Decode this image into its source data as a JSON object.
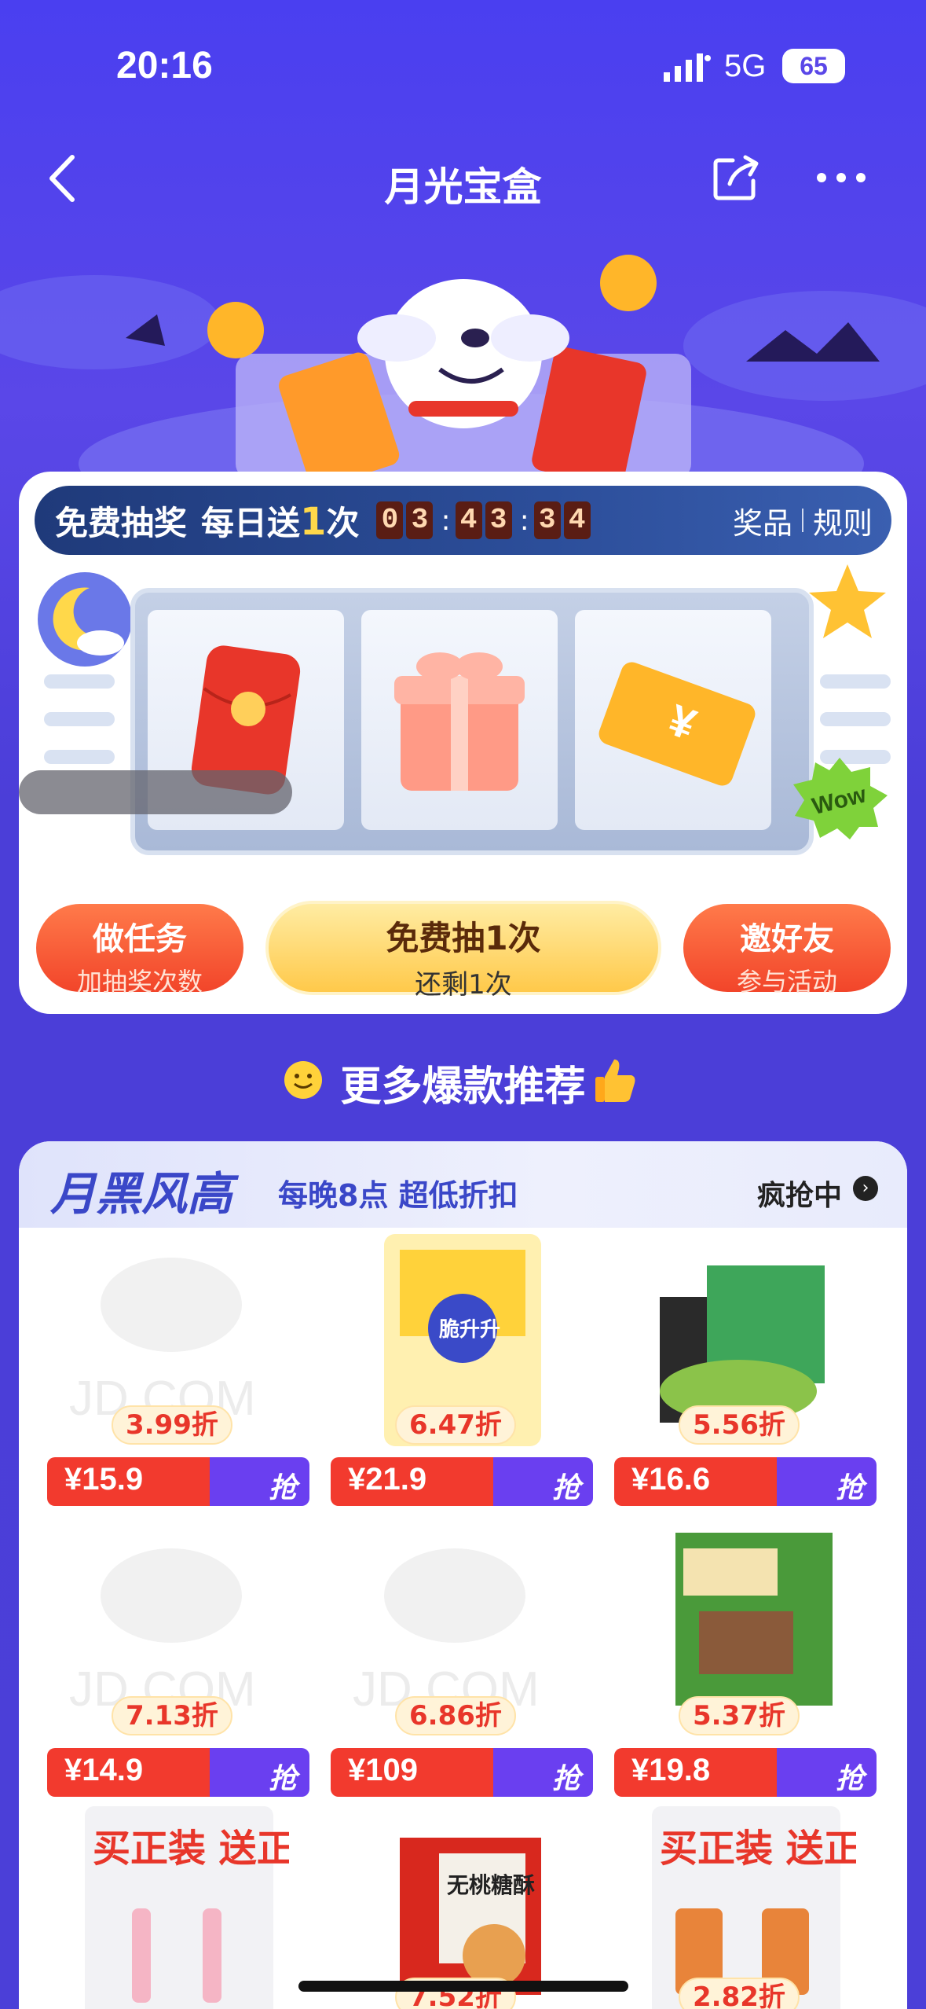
{
  "status_bar": {
    "time": "20:16",
    "network": "5G",
    "battery": "65"
  },
  "nav": {
    "title": "月光宝盒",
    "back_icon": "chevron-left-icon",
    "share_icon": "share-icon",
    "more_icon": "more-icon"
  },
  "lottery": {
    "title": "免费抽奖",
    "daily_prefix": "每日送",
    "daily_count": "1",
    "daily_suffix": "次",
    "countdown": [
      "0",
      "3",
      "4",
      "3",
      "3",
      "4"
    ],
    "prizes_link": "奖品",
    "rules_link": "规则",
    "slots": [
      "red-envelope-icon",
      "gift-box-icon",
      "coupon-icon"
    ],
    "task_button": {
      "label": "做任务",
      "sub": "加抽奖次数"
    },
    "draw_button": {
      "label": "免费抽1次",
      "sub": "还剩1次"
    },
    "invite_button": {
      "label": "邀好友",
      "sub": "参与活动"
    }
  },
  "section": {
    "title": "更多爆款推荐"
  },
  "deals": {
    "brand": "月黑风高",
    "subtitle": "每晚8点 超低折扣",
    "more_label": "疯抢中",
    "grab_label": "抢",
    "products": [
      {
        "discount": "3.99折",
        "price": "¥15.9",
        "image": "jd-placeholder"
      },
      {
        "discount": "6.47折",
        "price": "¥21.9",
        "image": "potato-sticks"
      },
      {
        "discount": "5.56折",
        "price": "¥16.6",
        "image": "seaweed-snack"
      },
      {
        "discount": "7.13折",
        "price": "¥14.9",
        "image": "jd-placeholder"
      },
      {
        "discount": "6.86折",
        "price": "¥109",
        "image": "jd-placeholder"
      },
      {
        "discount": "5.37折",
        "price": "¥19.8",
        "image": "cracker-box"
      },
      {
        "discount": "",
        "price": "",
        "image": "lip-gloss-promo"
      },
      {
        "discount": "7.52折",
        "price": "",
        "image": "pastry-giftbag"
      },
      {
        "discount": "2.82折",
        "price": "",
        "image": "cosmetic-promo"
      }
    ],
    "promo_text": "买正装 送正装",
    "promo_buy": "买",
    "promo_gift": "送",
    "jd_watermark": "JD.COM",
    "potato_brand": "脆升升",
    "pastry_label": "无桃糖酥"
  },
  "colors": {
    "primary_purple": "#4b3ed8",
    "accent_red": "#f23a2e",
    "accent_gold": "#ffc94a"
  }
}
